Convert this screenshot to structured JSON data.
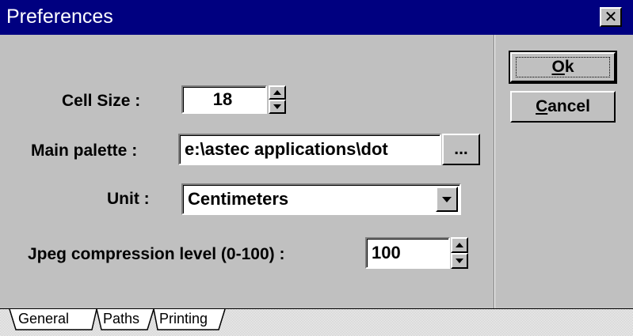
{
  "window": {
    "title": "Preferences",
    "close_symbol": "✕"
  },
  "fields": {
    "cell_size": {
      "label": "Cell Size :",
      "value": "18"
    },
    "main_palette": {
      "label": "Main palette :",
      "value": "e:\\astec applications\\dot",
      "browse_label": "..."
    },
    "unit": {
      "label": "Unit :",
      "value": "Centimeters"
    },
    "jpeg": {
      "label": "Jpeg compression level (0-100) :",
      "value": "100"
    }
  },
  "buttons": {
    "ok": {
      "mnemonic": "O",
      "rest": "k"
    },
    "cancel": {
      "mnemonic": "C",
      "rest": "ancel"
    }
  },
  "tabs": [
    "General",
    "Paths",
    "Printing"
  ],
  "colors": {
    "titlebar": "#000080",
    "face": "#c0c0c0"
  }
}
